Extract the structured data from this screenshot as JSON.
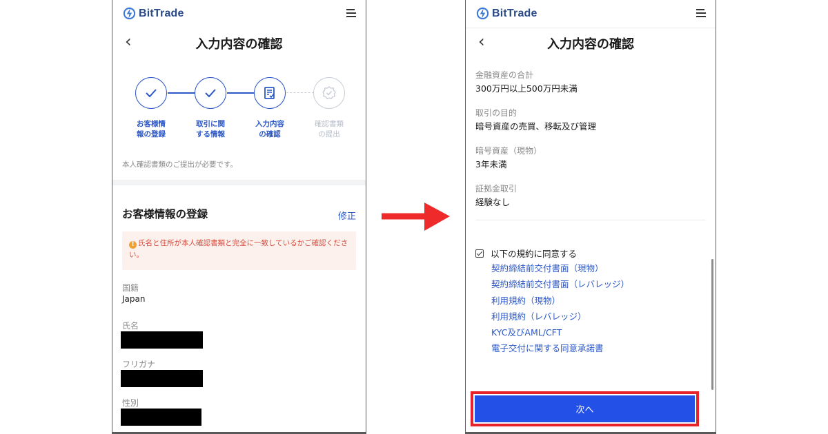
{
  "brand": {
    "name": "BitTrade",
    "color": "#2a4a8a"
  },
  "colors": {
    "accent": "#2b57c7",
    "button": "#2350e6",
    "highlight": "#e8222a",
    "warning_text": "#d64a3a"
  },
  "left_screen": {
    "title": "入力内容の確認",
    "steps": [
      {
        "label": "お客様情\n報の登録",
        "state": "done"
      },
      {
        "label": "取引に関\nする情報",
        "state": "done"
      },
      {
        "label": "入力内容\nの確認",
        "state": "current"
      },
      {
        "label": "確認書類\nの提出",
        "state": "pending"
      }
    ],
    "notice": "本人確認書類のご提出が必要です。",
    "section_title": "お客様情報の登録",
    "edit_label": "修正",
    "warning": "氏名と住所が本人確認書類と完全に一致しているかご確認ください。",
    "fields": [
      {
        "label": "国籍",
        "value": "Japan"
      },
      {
        "label": "氏名",
        "value": ""
      },
      {
        "label": "フリガナ",
        "value": ""
      },
      {
        "label": "性別",
        "value": ""
      }
    ]
  },
  "right_screen": {
    "title": "入力内容の確認",
    "fields": [
      {
        "label": "金融資産の合計",
        "value": "300万円以上500万円未満"
      },
      {
        "label": "取引の目的",
        "value": "暗号資産の売買、移転及び管理"
      },
      {
        "label": "暗号資産（現物）",
        "value": "3年未満"
      },
      {
        "label": "証拠金取引",
        "value": "経験なし"
      }
    ],
    "agree_label": "以下の規約に同意する",
    "agree_checked": true,
    "terms": [
      "契約締結前交付書面（現物）",
      "契約締結前交付書面（レバレッジ）",
      "利用規約（現物）",
      "利用規約（レバレッジ）",
      "KYC及びAML/CFT",
      "電子交付に関する同意承諾書"
    ],
    "next_button": "次へ"
  }
}
